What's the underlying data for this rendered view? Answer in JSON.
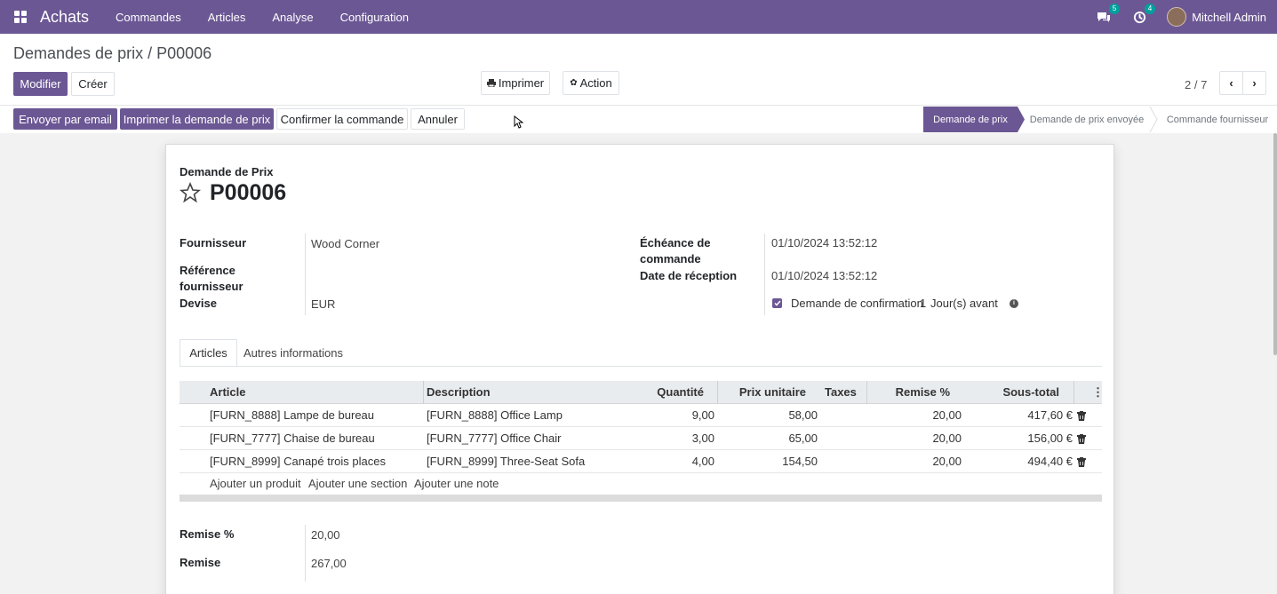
{
  "nav": {
    "app": "Achats",
    "menus": [
      "Commandes",
      "Articles",
      "Analyse",
      "Configuration"
    ],
    "chat_count": "5",
    "activity_count": "4",
    "user": "Mitchell Admin"
  },
  "breadcrumb": "Demandes de prix / P00006",
  "buttons": {
    "edit": "Modifier",
    "create": "Créer",
    "print": "Imprimer",
    "action": "Action"
  },
  "pager": "2 / 7",
  "actions": {
    "send": "Envoyer par email",
    "print_rfq": "Imprimer la demande de prix",
    "confirm": "Confirmer la commande",
    "cancel": "Annuler"
  },
  "status": [
    "Demande de prix",
    "Demande de prix envoyée",
    "Commande fournisseur"
  ],
  "form": {
    "subtitle": "Demande de Prix",
    "name": "P00006",
    "fields": {
      "vendor_label": "Fournisseur",
      "vendor": "Wood Corner",
      "ref_label1": "Référence",
      "ref_label2": "fournisseur",
      "currency_label": "Devise",
      "currency": "EUR",
      "deadline_label1": "Échéance de",
      "deadline_label2": "commande",
      "deadline": "01/10/2024 13:52:12",
      "receipt_label": "Date de réception",
      "receipt": "01/10/2024 13:52:12",
      "confirm_label": "Demande de confirmation",
      "confirm_days": "1",
      "confirm_unit": "Jour(s) avant"
    }
  },
  "tabs": [
    "Articles",
    "Autres informations"
  ],
  "table": {
    "headers": [
      "Article",
      "Description",
      "Quantité",
      "Prix unitaire",
      "Taxes",
      "Remise %",
      "Sous-total"
    ],
    "rows": [
      {
        "article": "[FURN_8888] Lampe de bureau",
        "desc": "[FURN_8888] Office Lamp",
        "qty": "9,00",
        "price": "58,00",
        "disc": "20,00",
        "subtotal": "417,60 €"
      },
      {
        "article": "[FURN_7777] Chaise de bureau",
        "desc": "[FURN_7777] Office Chair",
        "qty": "3,00",
        "price": "65,00",
        "disc": "20,00",
        "subtotal": "156,00 €"
      },
      {
        "article": "[FURN_8999] Canapé trois places",
        "desc": "[FURN_8999] Three-Seat Sofa",
        "qty": "4,00",
        "price": "154,50",
        "disc": "20,00",
        "subtotal": "494,40 €"
      }
    ],
    "add": [
      "Ajouter un produit",
      "Ajouter une section",
      "Ajouter une note"
    ]
  },
  "totals": {
    "disc_label": "Remise %",
    "disc": "20,00",
    "amount_label": "Remise",
    "amount": "267,00"
  }
}
